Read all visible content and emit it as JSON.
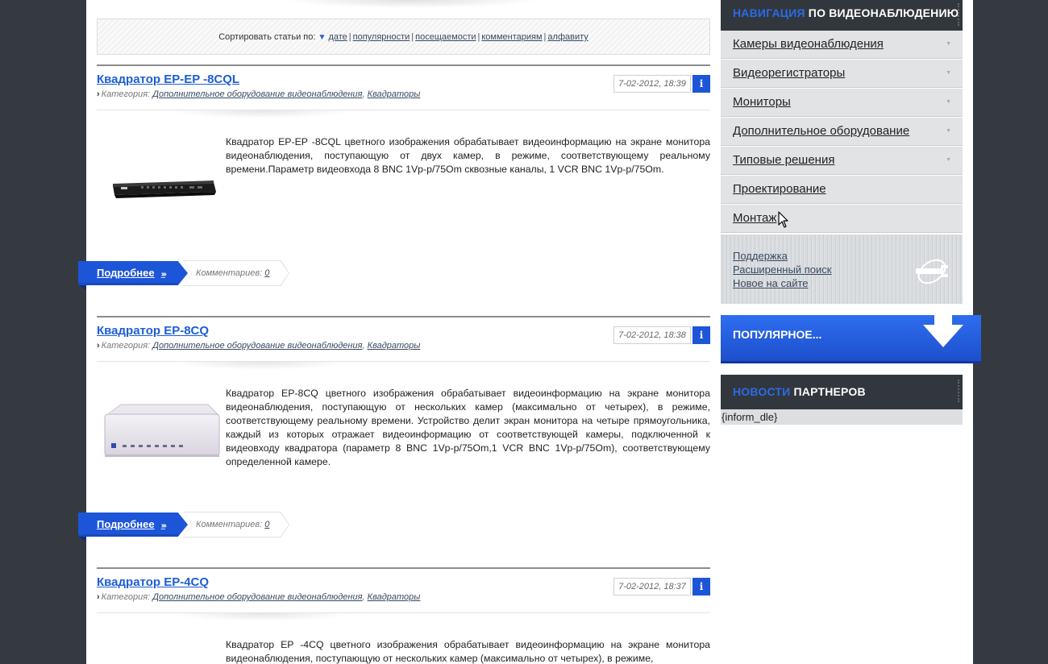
{
  "sort": {
    "label": "Сортировать статьи по:",
    "options": [
      "дате",
      "популярности",
      "посещаемости",
      "комментариям",
      "алфавиту"
    ]
  },
  "articles": [
    {
      "title": "Квадратор EP-EP -8CQL",
      "category_label": "Категория:",
      "categories": [
        "Дополнительное оборудование видеонаблюдения",
        "Квадраторы"
      ],
      "date": "7-02-2012, 18:39",
      "info": "i",
      "text": "Квадратор EP-EP -8CQL  цветного изображения обрабатывает видеоинформацию на экране монитора видеонаблюдения, поступающую от двух камер, в режиме, соответствующему реальному времени.Параметр видеовхода 8 BNC 1Vp-p/75Om сквозные каналы, 1 VCR BNC 1Vp-p/75Om.",
      "more": "Подробнее",
      "comments_label": "Комментариев:",
      "comments_count": "0"
    },
    {
      "title": "Квадратор EP-8CQ",
      "category_label": "Категория:",
      "categories": [
        "Дополнительное оборудование видеонаблюдения",
        "Квадраторы"
      ],
      "date": "7-02-2012, 18:38",
      "info": "i",
      "text": "Квадратор EP-8CQ  цветного изображения обрабатывает видеоинформацию на экране монитора видеонаблюдения, поступающую от нескольких камер (максимально от четырех), в режиме, соответствующему реальному времени. Устройство делит экран монитора на четыре прямоугольника, каждый из которых отражает видеоинформацию от соответствующей камеры, подключенной к видеовходу квадратора (параметр 8 BNC 1Vp-p/75Om,1 VCR BNC 1Vp-p/75Om), соответствующему определенной камере.",
      "more": "Подробнее",
      "comments_label": "Комментариев:",
      "comments_count": "0"
    },
    {
      "title": "Квадратор EP-4CQ",
      "category_label": "Категория:",
      "categories": [
        "Дополнительное оборудование видеонаблюдения",
        "Квадраторы"
      ],
      "date": "7-02-2012, 18:37",
      "info": "i",
      "text": "Квадратор EP -4CQ цветного изображения обрабатывает видеоинформацию на экране монитора видеонаблюдения, поступающую от нескольких камер (максимально от четырех), в режиме,"
    }
  ],
  "sidebar": {
    "nav_title_highlight": "НАВИГАЦИЯ",
    "nav_title_rest": " ПО ВИДЕОНАБЛЮДЕНИЮ",
    "nav_items": [
      {
        "label": "Камеры видеонаблюдения",
        "has_submenu": true
      },
      {
        "label": "Видеорегистраторы",
        "has_submenu": true
      },
      {
        "label": "Мониторы",
        "has_submenu": true
      },
      {
        "label": "Дополнительное оборудование",
        "has_submenu": true
      },
      {
        "label": "Типовые решения",
        "has_submenu": true
      },
      {
        "label": "Проектирование",
        "has_submenu": false
      },
      {
        "label": "Монтаж",
        "has_submenu": false
      }
    ],
    "links": [
      "Поддержка",
      "Расширенный поиск",
      "Новое на сайте"
    ],
    "popular_title": "ПОПУЛЯРНОЕ...",
    "partners_title_highlight": "НОВОСТИ",
    "partners_title_rest": " ПАРТНЕРОВ",
    "partners_body": "{inform_dle}"
  },
  "colors": {
    "accent": "#1d55d8",
    "background": "#353a41",
    "sidebar_head": "#32373d"
  },
  "icons": [
    "chevron-down-icon",
    "info-icon",
    "triangle-down-icon",
    "tool-icon",
    "arrow-down-icon",
    "cursor-icon"
  ]
}
